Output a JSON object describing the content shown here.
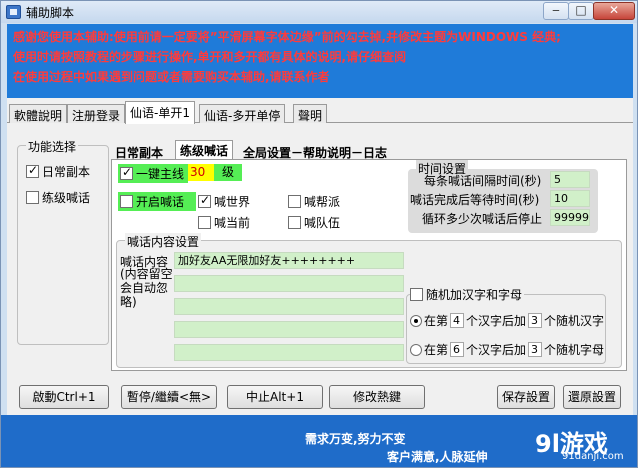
{
  "window": {
    "title": "辅助脚本",
    "buttons": {
      "minimize": "‒",
      "maximize": "□",
      "close": "✕"
    }
  },
  "notice": {
    "lines": [
      "感谢您使用本辅助:使用前请一定要将”平滑屏幕字体边缘”前的勾去掉,并修改主题为WINDOWS 经典;",
      "使用时请按照教程的步骤进行操作,单开和多开都有具体的说明,请仔细查阅",
      "在使用过程中如果遇到问题或者需要购买本辅助,请联系作者"
    ],
    "color": "#ff3b3b"
  },
  "main_tabs": [
    "軟體說明",
    "注册登录",
    "仙语-单开1",
    "仙语-多开单停",
    "聲明"
  ],
  "features": {
    "title": "功能选择",
    "items": [
      {
        "label": "日常副本",
        "checked": true
      },
      {
        "label": "练级喊话",
        "checked": false
      }
    ]
  },
  "sub_tabs": [
    "日常副本",
    "练级喊话",
    "全局设置－帮助说明－日志"
  ],
  "mainline": {
    "label": "一键主线",
    "checked": true,
    "level": "30",
    "level_unit": "级"
  },
  "shout": {
    "start_label": "开启喊话",
    "start_checked": false,
    "channels": [
      {
        "label": "喊世界",
        "checked": true
      },
      {
        "label": "喊帮派",
        "checked": false
      },
      {
        "label": "喊当前",
        "checked": false
      },
      {
        "label": "喊队伍",
        "checked": false
      }
    ]
  },
  "timing": {
    "title": "时间设置",
    "rows": [
      {
        "label": "每条喊话间隔时间(秒)",
        "value": "5"
      },
      {
        "label": "喊话完成后等待时间(秒)",
        "value": "10"
      },
      {
        "label": "循环多少次喊话后停止",
        "value": "99999"
      }
    ]
  },
  "content": {
    "title": "喊话内容设置",
    "label_main": "喊话内容",
    "label_note": "(内容留空会自动忽略)",
    "inputs": [
      "加好友AA无限加好友++++++++",
      "",
      "",
      "",
      ""
    ]
  },
  "random": {
    "label": "随机加汉字和字母",
    "checked": false,
    "options": [
      {
        "prefix": "在第",
        "pos": "4",
        "mid": "个汉字后加",
        "count": "3",
        "suffix": "个随机汉字",
        "selected": true
      },
      {
        "prefix": "在第",
        "pos": "6",
        "mid": "个汉字后加",
        "count": "3",
        "suffix": "个随机字母",
        "selected": false
      }
    ]
  },
  "buttons": {
    "start": "啟動Ctrl+1",
    "pause": "暫停/繼續<無>",
    "stop": "中止Alt+1",
    "hotkey": "修改熱鍵",
    "save": "保存設置",
    "restore": "還原設置"
  },
  "status": {
    "line1": "需求万变,努力不变",
    "line2": "客户满意,人脉延伸",
    "watermark": "9l游戏",
    "watermark_url": "91danji.com"
  },
  "colors": {
    "titlebar": "#c5d8ee",
    "notice_bg": "#1f7bd9",
    "status_bg": "#1f6cc9",
    "field_green": "#d1f0c9",
    "highlight_yellow": "#ffff00",
    "highlight_green": "#55ee55"
  }
}
